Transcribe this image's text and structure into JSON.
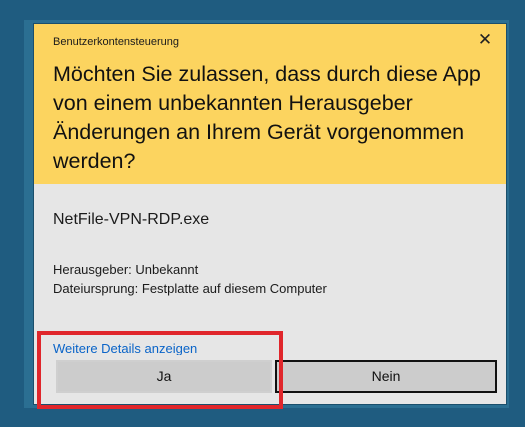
{
  "dialog": {
    "caption": "Benutzerkontensteuerung",
    "close_glyph": "✕",
    "question": "Möchten Sie zulassen, dass durch diese App von einem unbekannten Herausgeber Änderungen an Ihrem Gerät vorgenommen werden?",
    "program_name": "NetFile-VPN-RDP.exe",
    "publisher_line": "Herausgeber: Unbekannt",
    "origin_line": "Dateiursprung: Festplatte auf diesem Computer",
    "details_link": "Weitere Details anzeigen",
    "yes_label": "Ja",
    "no_label": "Nein"
  },
  "colors": {
    "header_bg": "#fcd45f",
    "body_bg": "#e6e6e6",
    "link": "#0a64c8",
    "annotation_box": "#e0262b",
    "desktop": "#1f5c80"
  }
}
